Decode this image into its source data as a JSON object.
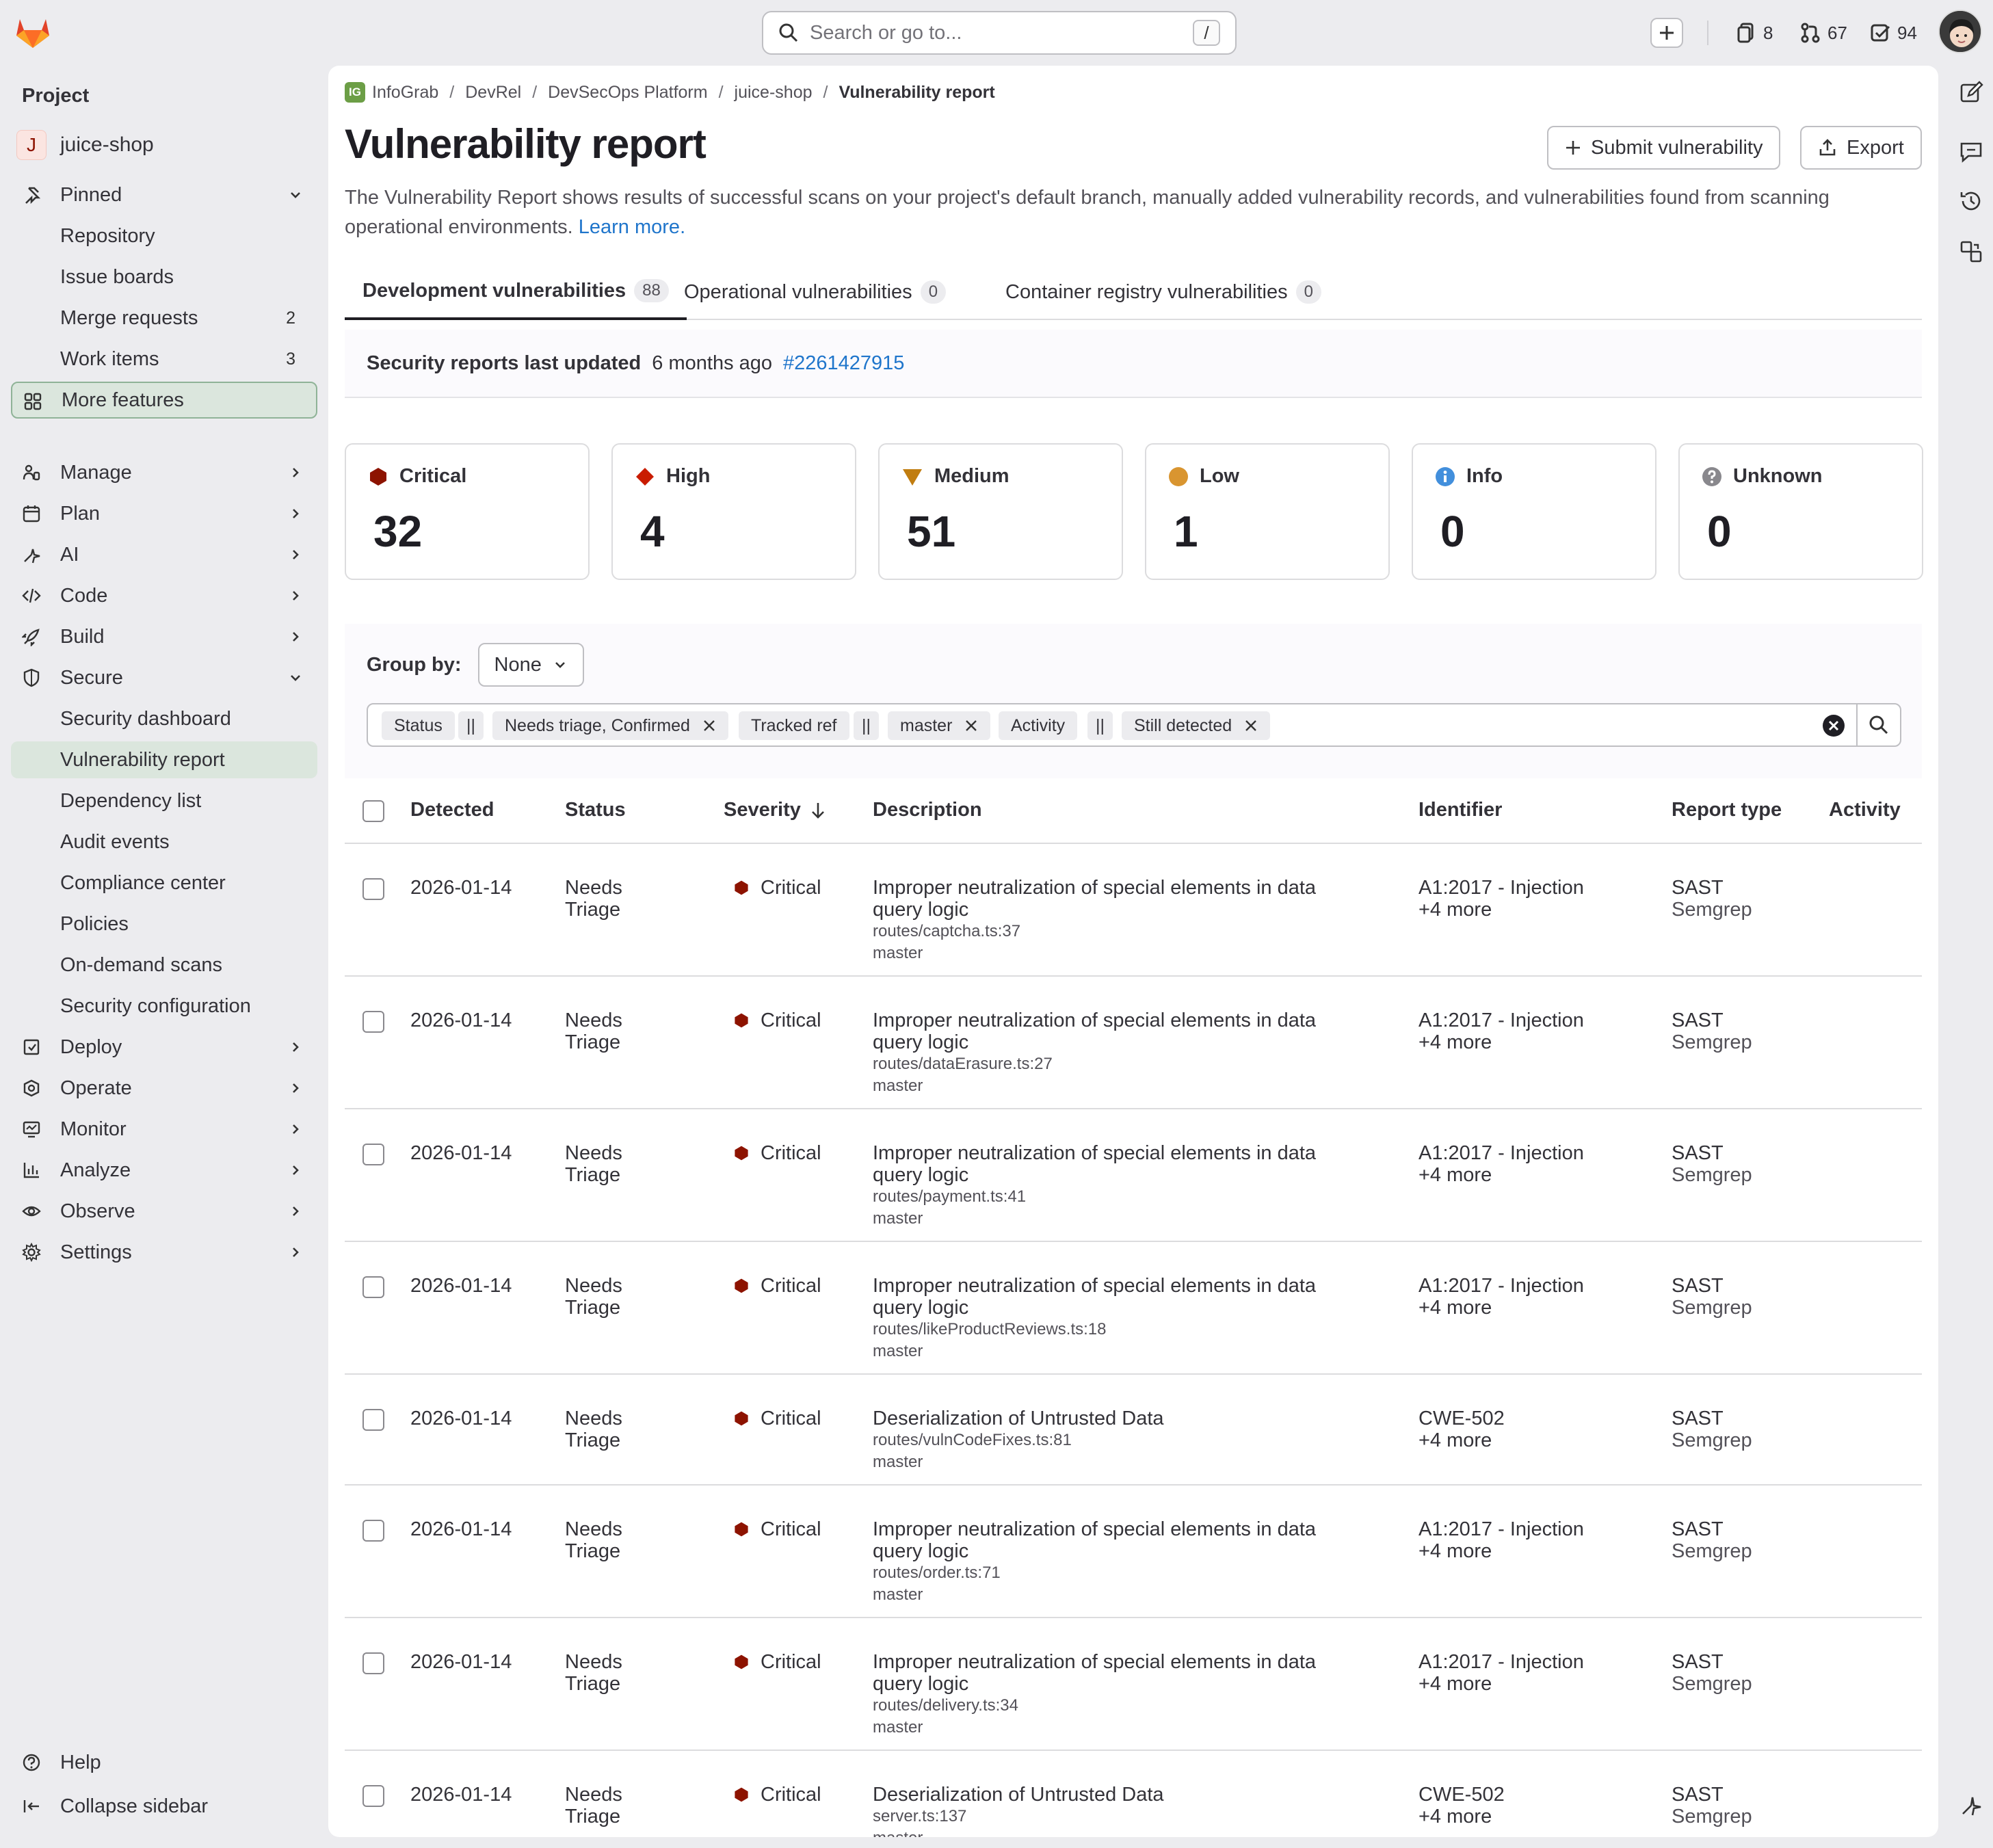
{
  "topbar": {
    "search_placeholder": "Search or go to...",
    "search_shortcut": "/",
    "issues_count": "8",
    "merge_requests_count": "67",
    "todos_count": "94"
  },
  "sidebar": {
    "heading": "Project",
    "project_initial": "J",
    "project_name": "juice-shop",
    "pinned": "Pinned",
    "pinned_items": [
      {
        "label": "Repository",
        "count": ""
      },
      {
        "label": "Issue boards",
        "count": ""
      },
      {
        "label": "Merge requests",
        "count": "2"
      },
      {
        "label": "Work items",
        "count": "3"
      }
    ],
    "more_features": "More features",
    "sections": [
      "Manage",
      "Plan",
      "AI",
      "Code",
      "Build",
      "Secure"
    ],
    "secure_items": [
      "Security dashboard",
      "Vulnerability report",
      "Dependency list",
      "Audit events",
      "Compliance center",
      "Policies",
      "On-demand scans",
      "Security configuration"
    ],
    "sections_after": [
      "Deploy",
      "Operate",
      "Monitor",
      "Analyze",
      "Observe",
      "Settings"
    ],
    "help": "Help",
    "collapse": "Collapse sidebar"
  },
  "breadcrumb": {
    "logo_text": "IG",
    "items": [
      "InfoGrab",
      "DevRel",
      "DevSecOps Platform",
      "juice-shop"
    ],
    "current": "Vulnerability report"
  },
  "page": {
    "title": "Vulnerability report",
    "submit_button": "Submit vulnerability",
    "export_button": "Export",
    "description": "The Vulnerability Report shows results of successful scans on your project's default branch, manually added vulnerability records, and vulnerabilities found from scanning operational environments.",
    "learn_more": "Learn more."
  },
  "tabs": [
    {
      "label": "Development vulnerabilities",
      "count": "88"
    },
    {
      "label": "Operational vulnerabilities",
      "count": "0"
    },
    {
      "label": "Container registry vulnerabilities",
      "count": "0"
    }
  ],
  "last_updated": {
    "label": "Security reports last updated",
    "when": "6 months ago",
    "pipeline": "#2261427915"
  },
  "severity_cards": [
    {
      "label": "Critical",
      "count": "32",
      "color": "#8d1300"
    },
    {
      "label": "High",
      "count": "4",
      "color": "#c91c00"
    },
    {
      "label": "Medium",
      "count": "51",
      "color": "#c17d10"
    },
    {
      "label": "Low",
      "count": "1",
      "color": "#d99530"
    },
    {
      "label": "Info",
      "count": "0",
      "color": "#428fdc"
    },
    {
      "label": "Unknown",
      "count": "0",
      "color": "#89888d"
    }
  ],
  "filters": {
    "group_by_label": "Group by:",
    "group_by_value": "None",
    "tokens": [
      {
        "key": "Status",
        "op": "||",
        "value": "Needs triage, Confirmed"
      },
      {
        "key": "Tracked ref",
        "op": "||",
        "value": "master"
      },
      {
        "key": "Activity",
        "op": "||",
        "value": "Still detected"
      }
    ]
  },
  "table": {
    "headers": [
      "Detected",
      "Status",
      "Severity",
      "Description",
      "Identifier",
      "Report type",
      "Activity"
    ],
    "rows": [
      {
        "detected": "2026-01-14",
        "status1": "Needs",
        "status2": "Triage",
        "severity": "Critical",
        "desc1": "Improper neutralization of special elements in data",
        "desc2": "query logic",
        "file": "routes/captcha.ts:37",
        "branch": "master",
        "id1": "A1:2017 - Injection",
        "id2": "+4 more",
        "type1": "SAST",
        "type2": "Semgrep"
      },
      {
        "detected": "2026-01-14",
        "status1": "Needs",
        "status2": "Triage",
        "severity": "Critical",
        "desc1": "Improper neutralization of special elements in data",
        "desc2": "query logic",
        "file": "routes/dataErasure.ts:27",
        "branch": "master",
        "id1": "A1:2017 - Injection",
        "id2": "+4 more",
        "type1": "SAST",
        "type2": "Semgrep"
      },
      {
        "detected": "2026-01-14",
        "status1": "Needs",
        "status2": "Triage",
        "severity": "Critical",
        "desc1": "Improper neutralization of special elements in data",
        "desc2": "query logic",
        "file": "routes/payment.ts:41",
        "branch": "master",
        "id1": "A1:2017 - Injection",
        "id2": "+4 more",
        "type1": "SAST",
        "type2": "Semgrep"
      },
      {
        "detected": "2026-01-14",
        "status1": "Needs",
        "status2": "Triage",
        "severity": "Critical",
        "desc1": "Improper neutralization of special elements in data",
        "desc2": "query logic",
        "file": "routes/likeProductReviews.ts:18",
        "branch": "master",
        "id1": "A1:2017 - Injection",
        "id2": "+4 more",
        "type1": "SAST",
        "type2": "Semgrep"
      },
      {
        "detected": "2026-01-14",
        "status1": "Needs",
        "status2": "Triage",
        "severity": "Critical",
        "desc1": "Deserialization of Untrusted Data",
        "desc2": "",
        "file": "routes/vulnCodeFixes.ts:81",
        "branch": "master",
        "id1": "CWE-502",
        "id2": "+4 more",
        "type1": "SAST",
        "type2": "Semgrep"
      },
      {
        "detected": "2026-01-14",
        "status1": "Needs",
        "status2": "Triage",
        "severity": "Critical",
        "desc1": "Improper neutralization of special elements in data",
        "desc2": "query logic",
        "file": "routes/order.ts:71",
        "branch": "master",
        "id1": "A1:2017 - Injection",
        "id2": "+4 more",
        "type1": "SAST",
        "type2": "Semgrep"
      },
      {
        "detected": "2026-01-14",
        "status1": "Needs",
        "status2": "Triage",
        "severity": "Critical",
        "desc1": "Improper neutralization of special elements in data",
        "desc2": "query logic",
        "file": "routes/delivery.ts:34",
        "branch": "master",
        "id1": "A1:2017 - Injection",
        "id2": "+4 more",
        "type1": "SAST",
        "type2": "Semgrep"
      },
      {
        "detected": "2026-01-14",
        "status1": "Needs",
        "status2": "Triage",
        "severity": "Critical",
        "desc1": "Deserialization of Untrusted Data",
        "desc2": "",
        "file": "server.ts:137",
        "branch": "master",
        "id1": "CWE-502",
        "id2": "+4 more",
        "type1": "SAST",
        "type2": "Semgrep"
      }
    ]
  }
}
